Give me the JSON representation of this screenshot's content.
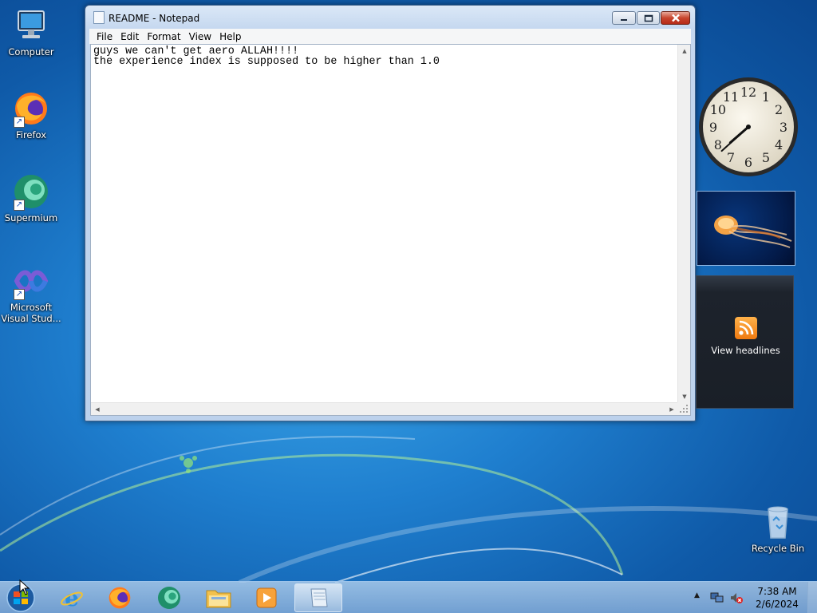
{
  "desktop": {
    "icons": [
      {
        "label": "Computer",
        "icon": "computer-icon"
      },
      {
        "label": "Firefox",
        "icon": "firefox-icon"
      },
      {
        "label": "Supermium",
        "icon": "supermium-icon"
      },
      {
        "label": "Microsoft Visual Stud...",
        "icon": "visual-studio-icon"
      },
      {
        "label": "Recycle Bin",
        "icon": "recycle-bin-icon"
      }
    ]
  },
  "notepad": {
    "title": "README - Notepad",
    "menu": [
      "File",
      "Edit",
      "Format",
      "View",
      "Help"
    ],
    "content": "guys we can't get aero ALLAH!!!!\nthe experience index is supposed to be higher than 1.0"
  },
  "gadgets": {
    "clock_time": "7:38",
    "clock_numbers": [
      "12",
      "1",
      "2",
      "3",
      "4",
      "5",
      "6",
      "7",
      "8",
      "9",
      "10",
      "11"
    ],
    "feed_label": "View headlines"
  },
  "taskbar": {
    "pinned": [
      "start-orb-icon",
      "internet-explorer-icon",
      "firefox-icon",
      "supermium-icon",
      "file-explorer-icon",
      "media-player-icon",
      "notepad-icon"
    ],
    "tray": {
      "time": "7:38 AM",
      "date": "2/6/2024"
    }
  },
  "colors": {
    "desktop_blue": "#1f7fcf",
    "close_red": "#c8452e",
    "rss_orange": "#f07a10"
  }
}
